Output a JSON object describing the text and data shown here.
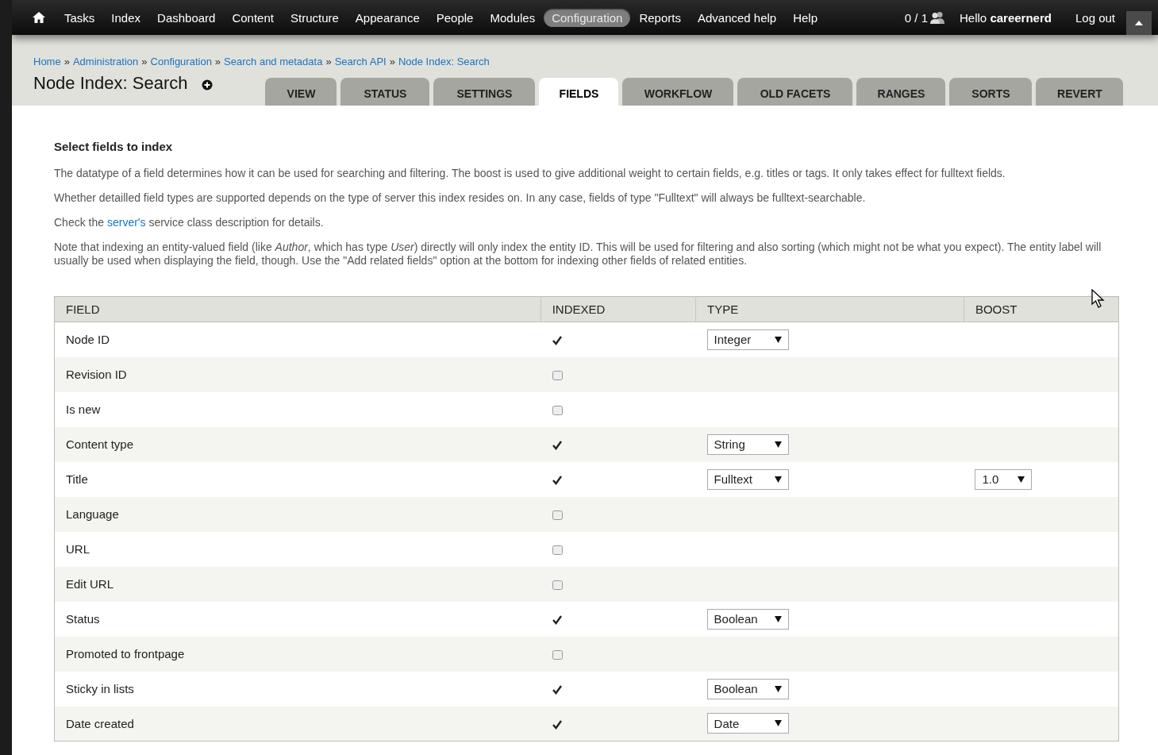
{
  "toolbar": {
    "items": [
      {
        "label": "Tasks",
        "selected": false
      },
      {
        "label": "Index",
        "selected": false
      },
      {
        "label": "Dashboard",
        "selected": false
      },
      {
        "label": "Content",
        "selected": false
      },
      {
        "label": "Structure",
        "selected": false
      },
      {
        "label": "Appearance",
        "selected": false
      },
      {
        "label": "People",
        "selected": false
      },
      {
        "label": "Modules",
        "selected": false
      },
      {
        "label": "Configuration",
        "selected": true
      },
      {
        "label": "Reports",
        "selected": false
      },
      {
        "label": "Advanced help",
        "selected": false
      },
      {
        "label": "Help",
        "selected": false
      }
    ],
    "users_online": "0 / 1",
    "greeting": "Hello **careernerd**",
    "logout": "Log out"
  },
  "breadcrumb": [
    "Home",
    "Administration",
    "Configuration",
    "Search and metadata",
    "Search API",
    "Node Index: Search"
  ],
  "breadcrumb_separator": "»",
  "page_title": "Node Index: Search",
  "tabs": [
    {
      "label": "VIEW",
      "selected": false
    },
    {
      "label": "STATUS",
      "selected": false
    },
    {
      "label": "SETTINGS",
      "selected": false
    },
    {
      "label": "FIELDS",
      "selected": true
    },
    {
      "label": "WORKFLOW",
      "selected": false
    },
    {
      "label": "OLD FACETS",
      "selected": false
    },
    {
      "label": "RANGES",
      "selected": false
    },
    {
      "label": "SORTS",
      "selected": false
    },
    {
      "label": "REVERT",
      "selected": false
    }
  ],
  "section_title": "Select fields to index",
  "paragraphs": [
    {
      "text": "The datatype of a field determines how it can be used for searching and filtering. The boost is used to give additional weight to certain fields, e.g. titles or tags. It only takes effect for fulltext fields."
    },
    {
      "text": "Whether detailled field types are supported depends on the type of server this index resides on. In any case, fields of type \"Fulltext\" will always be fulltext-searchable."
    },
    {
      "text": "Check the ",
      "link": "server's",
      "after": " service class description for details."
    },
    {
      "text": "Note that indexing an entity-valued field (like *Author*, which has type *User*) directly will only index the entity ID. This will be used for filtering and also sorting (which might not be what you expect). The entity label will usually be used when displaying the field, though. Use the \"Add related fields\" option at the bottom for indexing other fields of related entities."
    }
  ],
  "table": {
    "columns": [
      "FIELD",
      "INDEXED",
      "TYPE",
      "BOOST"
    ],
    "rows": [
      {
        "field": "Node ID",
        "indexed": true,
        "type": "Integer"
      },
      {
        "field": "Revision ID",
        "indexed": false
      },
      {
        "field": "Is new",
        "indexed": false
      },
      {
        "field": "Content type",
        "indexed": true,
        "type": "String"
      },
      {
        "field": "Title",
        "indexed": true,
        "type": "Fulltext",
        "boost": "1.0"
      },
      {
        "field": "Language",
        "indexed": false
      },
      {
        "field": "URL",
        "indexed": false
      },
      {
        "field": "Edit URL",
        "indexed": false
      },
      {
        "field": "Status",
        "indexed": true,
        "type": "Boolean"
      },
      {
        "field": "Promoted to frontpage",
        "indexed": false
      },
      {
        "field": "Sticky in lists",
        "indexed": true,
        "type": "Boolean"
      },
      {
        "field": "Date created",
        "indexed": true,
        "type": "Date"
      }
    ]
  }
}
